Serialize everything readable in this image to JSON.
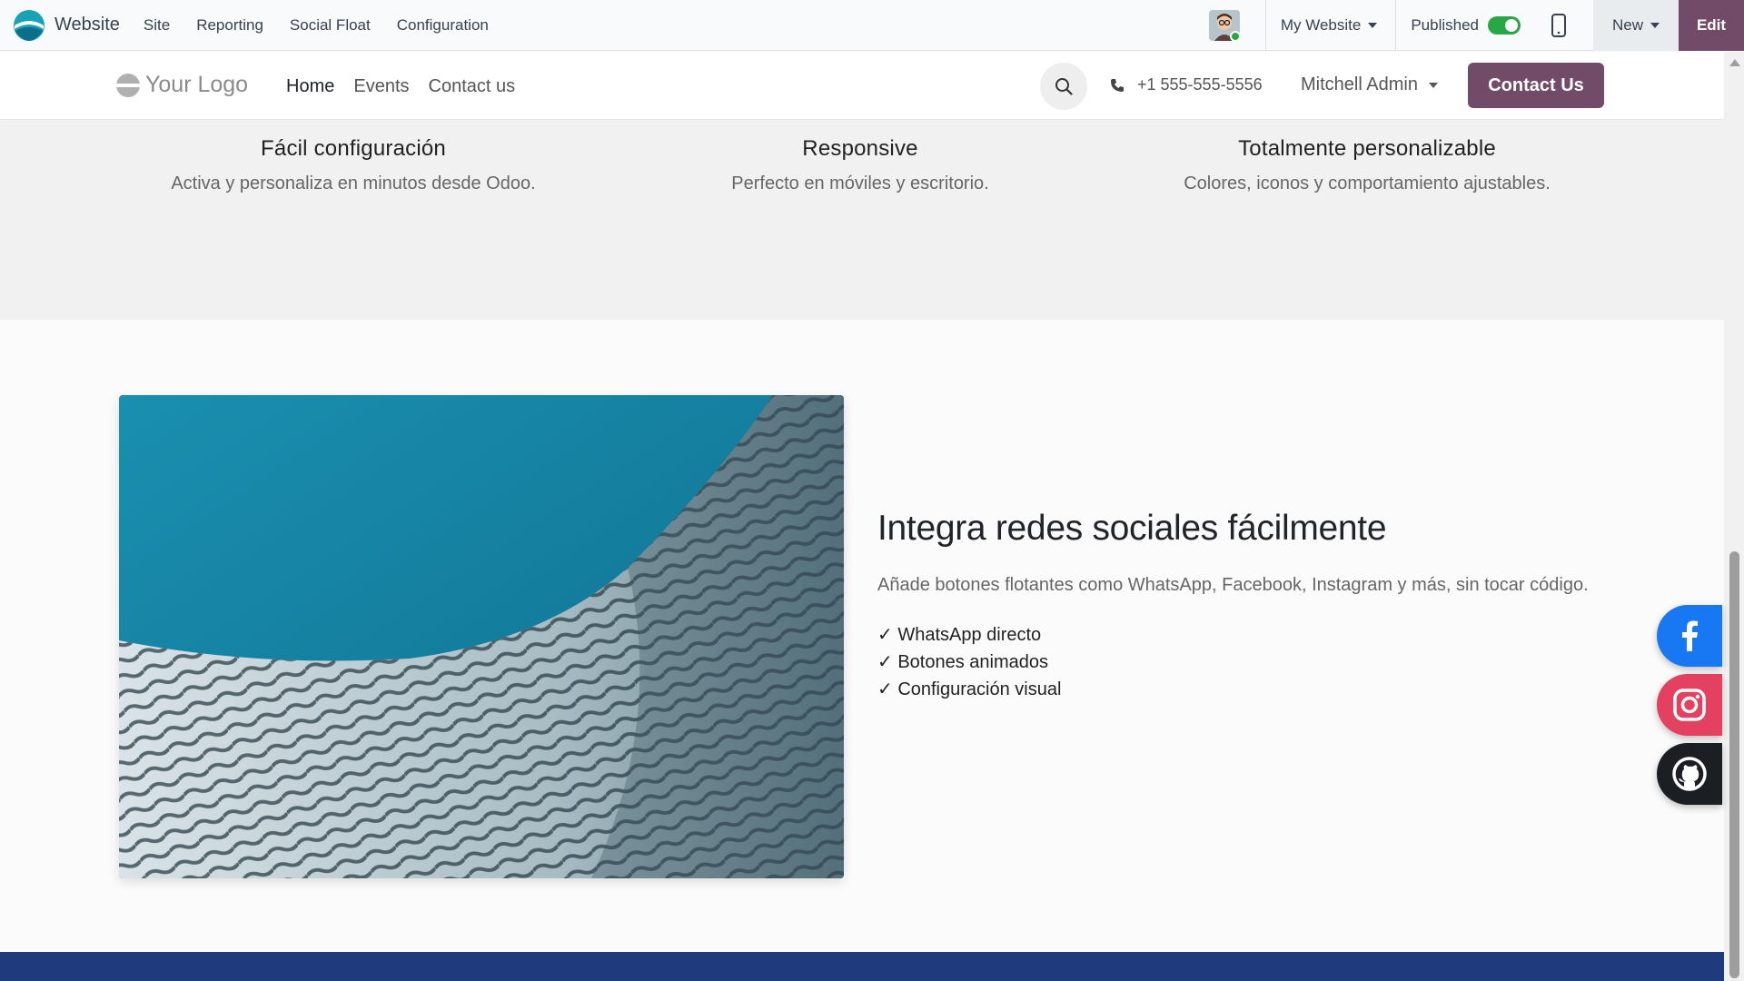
{
  "admin_bar": {
    "app_name": "Website",
    "menu": [
      "Site",
      "Reporting",
      "Social Float",
      "Configuration"
    ],
    "website_selector": "My Website",
    "published_label": "Published",
    "published": true,
    "new_label": "New",
    "edit_label": "Edit"
  },
  "header": {
    "logo_text": "Your Logo",
    "nav": [
      "Home",
      "Events",
      "Contact us"
    ],
    "active_nav": "Home",
    "phone": "+1 555-555-5556",
    "user": "Mitchell Admin",
    "cta": "Contact Us"
  },
  "features": [
    {
      "title": "Fácil configuración",
      "text": "Activa y personaliza en minutos desde Odoo."
    },
    {
      "title": "Responsive",
      "text": "Perfecto en móviles y escritorio."
    },
    {
      "title": "Totalmente personalizable",
      "text": "Colores, iconos y comportamiento ajustables."
    }
  ],
  "section": {
    "heading": "Integra redes sociales fácilmente",
    "description": "Añade botones flotantes como WhatsApp, Facebook, Instagram y más, sin tocar código.",
    "checklist": [
      "✓ WhatsApp directo",
      "✓ Botones animados",
      "✓ Configuración visual"
    ]
  },
  "floating_social": [
    "facebook-icon",
    "instagram-icon",
    "github-icon"
  ],
  "colors": {
    "brand": "#714b67",
    "facebook": "#1877f2",
    "instagram": "#e4405f",
    "github": "#1b1f23",
    "footer": "#1f3a7d",
    "published_toggle": "#28a745"
  }
}
